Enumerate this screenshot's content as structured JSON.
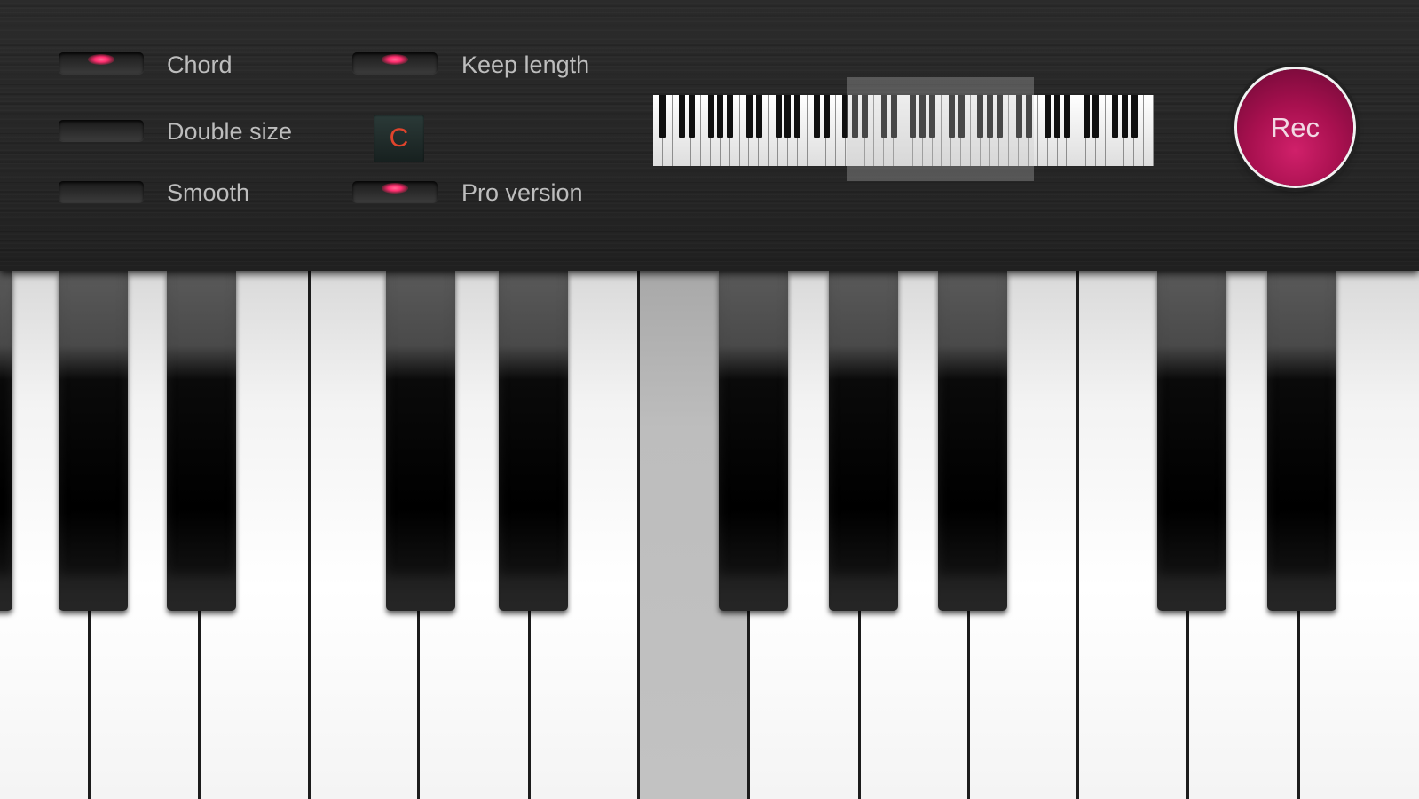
{
  "toggles": {
    "chord": {
      "label": "Chord",
      "on": true
    },
    "keep_length": {
      "label": "Keep length",
      "on": true
    },
    "double_size": {
      "label": "Double size",
      "on": false
    },
    "smooth": {
      "label": "Smooth",
      "on": false
    },
    "pro_version": {
      "label": "Pro version",
      "on": true
    }
  },
  "key_selector": {
    "label": "C"
  },
  "record": {
    "label": "Rec"
  },
  "colors": {
    "led_on": "#ff2d6f",
    "rec_button": "#a8104f",
    "key_label": "#e0442c"
  },
  "keyboard": {
    "pressed_key": "white-key-6"
  }
}
